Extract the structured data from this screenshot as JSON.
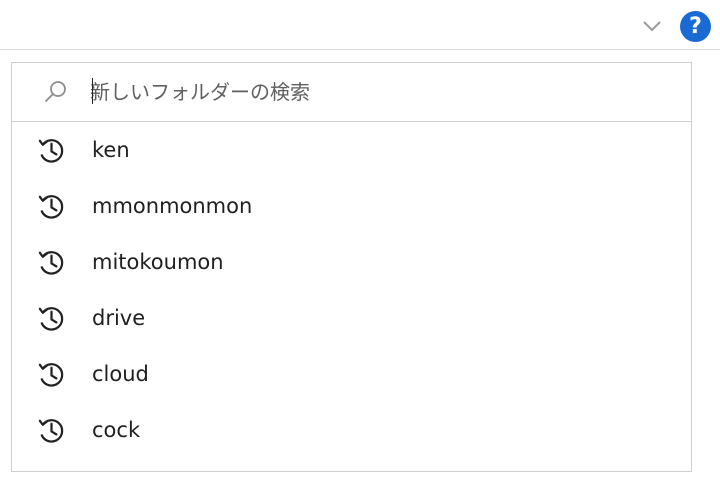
{
  "toolbar": {
    "chevron_icon": "chevron-down-icon",
    "help_icon": "help-icon",
    "help_label": "?"
  },
  "search": {
    "placeholder": "新しいフォルダーの検索",
    "value": ""
  },
  "history": [
    {
      "label": "ken",
      "icon": "history-icon"
    },
    {
      "label": "mmonmonmon",
      "icon": "history-icon"
    },
    {
      "label": "mitokoumon",
      "icon": "history-icon"
    },
    {
      "label": "drive",
      "icon": "history-icon"
    },
    {
      "label": "cloud",
      "icon": "history-icon"
    },
    {
      "label": "cock",
      "icon": "history-icon"
    }
  ],
  "colors": {
    "help_blue": "#1a6ad6",
    "border_gray": "#cfcfcf",
    "text": "#202020"
  }
}
